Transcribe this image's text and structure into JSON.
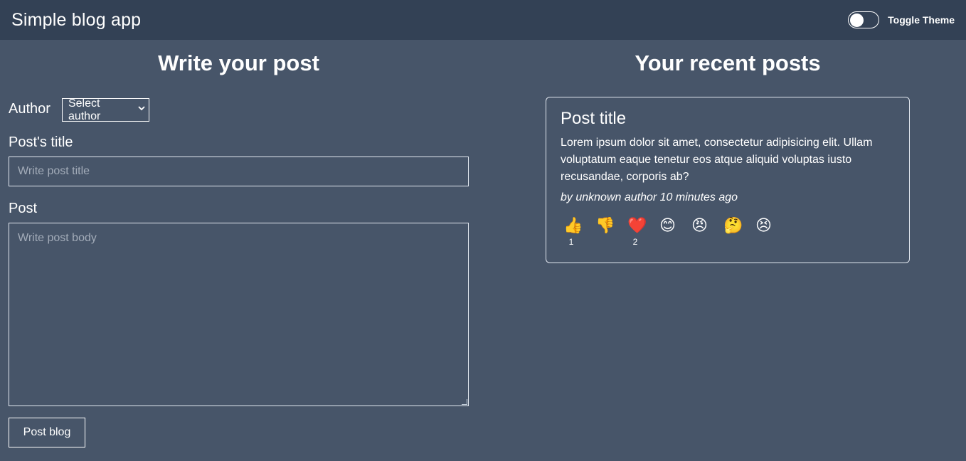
{
  "navbar": {
    "brand": "Simple blog app",
    "toggle_label": "Toggle Theme"
  },
  "form": {
    "heading": "Write your post",
    "author_label": "Author",
    "author_select_value": "Select author",
    "title_label": "Post's title",
    "title_placeholder": "Write post title",
    "body_label": "Post",
    "body_placeholder": "Write post body",
    "submit_label": "Post blog"
  },
  "posts": {
    "heading": "Your recent posts",
    "items": [
      {
        "title": "Post title",
        "body": "Lorem ipsum dolor sit amet, consectetur adipisicing elit. Ullam voluptatum eaque tenetur eos atque aliquid voluptas iusto recusandae, corporis ab?",
        "meta": "by unknown author 10 minutes ago",
        "reactions": [
          {
            "name": "thumbs-up-icon",
            "emoji": "👍",
            "count": "1"
          },
          {
            "name": "thumbs-down-icon",
            "emoji": "👎",
            "count": ""
          },
          {
            "name": "heart-icon",
            "emoji": "❤️",
            "count": "2"
          },
          {
            "name": "smile-icon",
            "emoji": "😊",
            "count": ""
          },
          {
            "name": "angry-icon",
            "emoji": "😠",
            "count": ""
          },
          {
            "name": "thinking-icon",
            "emoji": "🤔",
            "count": ""
          },
          {
            "name": "sad-icon",
            "emoji": "😣",
            "count": ""
          }
        ]
      }
    ]
  }
}
